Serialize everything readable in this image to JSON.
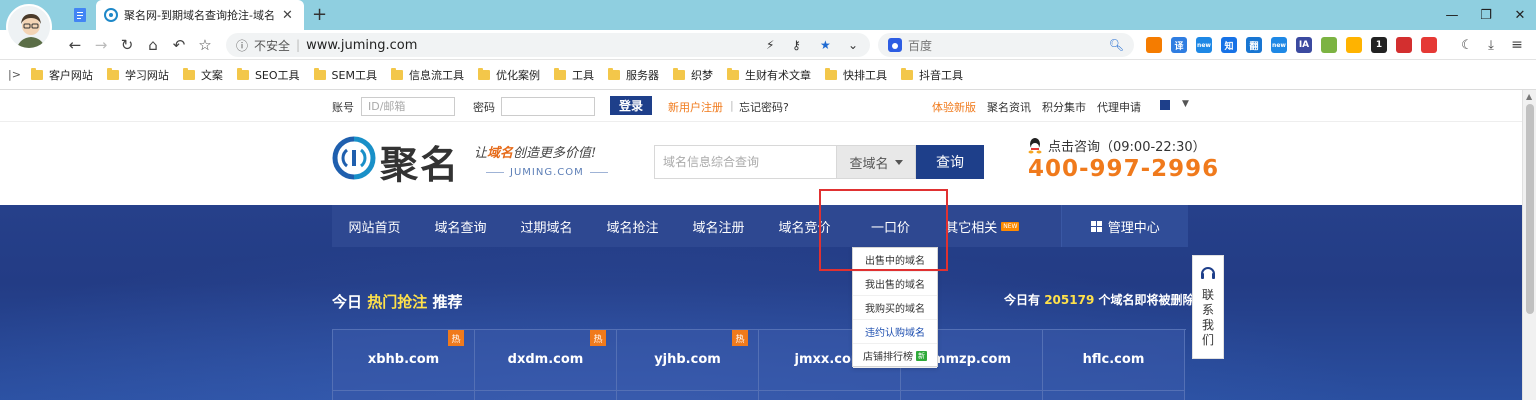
{
  "browser": {
    "tabs": [
      {
        "title": ""
      },
      {
        "title": "聚名网-到期域名查询抢注-域名注"
      }
    ],
    "new_tab_glyph": "+",
    "window_controls": {
      "minimize": "—",
      "restore": "❐",
      "close": "✕"
    },
    "address": {
      "security": "不安全",
      "url": "www.juming.com"
    },
    "search_engine_placeholder": "百度",
    "extensions": [
      {
        "label": "",
        "color": "#f57c00"
      },
      {
        "label": "译",
        "color": "#2f7de1"
      },
      {
        "label": "new",
        "color": "#1e88e5"
      },
      {
        "label": "知",
        "color": "#1772e6"
      },
      {
        "label": "翻",
        "color": "#1976d2"
      },
      {
        "label": "new",
        "color": "#1e88e5"
      },
      {
        "label": "IA",
        "color": "#3b4aa0"
      },
      {
        "label": "",
        "color": "#7cb342"
      },
      {
        "label": "",
        "color": "#ffb300"
      },
      {
        "label": "1",
        "color": "#222222"
      },
      {
        "label": "",
        "color": "#d32f2f"
      },
      {
        "label": "",
        "color": "#e53935"
      }
    ],
    "bookmarks": [
      "客户网站",
      "学习网站",
      "文案",
      "SEO工具",
      "SEM工具",
      "信息流工具",
      "优化案例",
      "工具",
      "服务器",
      "织梦",
      "生财有术文章",
      "快排工具",
      "抖音工具"
    ]
  },
  "topbar": {
    "account_label": "账号",
    "account_placeholder": "ID/邮箱",
    "password_label": "密码",
    "login": "登录",
    "register": "新用户注册",
    "forgot": "忘记密码?",
    "links": [
      "体验新版",
      "聚名资讯",
      "积分集市",
      "代理申请"
    ]
  },
  "header": {
    "logo_text": "聚名",
    "slogan_pre": "让",
    "slogan_hl": "域名",
    "slogan_post": "创造更多价值!",
    "slogan_sub": "JUMING.COM",
    "search_placeholder": "域名信息综合查询",
    "search_select": "查域名",
    "search_button": "查询",
    "contact": "点击咨询（09:00-22:30）",
    "phone": "400-997-2996"
  },
  "nav": {
    "items": [
      "网站首页",
      "域名查询",
      "过期域名",
      "域名抢注",
      "域名注册",
      "域名竞价",
      "一口价",
      "其它相关"
    ],
    "new_tag": "NEW",
    "management": "管理中心"
  },
  "dropdown": {
    "items": [
      "出售中的域名",
      "我出售的域名",
      "我购买的域名",
      "违约认购域名",
      "店铺排行榜"
    ],
    "new_badge": "新"
  },
  "section": {
    "title_pre": "今日",
    "title_hot": "热门抢注",
    "title_post": "推荐",
    "right_pre": "今日有",
    "right_num": "205179",
    "right_post": "个域名即将被删除"
  },
  "tiles": [
    {
      "domain": "xbhb.com",
      "tag": "热"
    },
    {
      "domain": "dxdm.com",
      "tag": "热"
    },
    {
      "domain": "yjhb.com",
      "tag": "热"
    },
    {
      "domain": "jmxx.com",
      "tag": ""
    },
    {
      "domain": "mmzp.com",
      "tag": ""
    },
    {
      "domain": "hflc.com",
      "tag": ""
    }
  ],
  "side_contact": "联系我们",
  "colors": {
    "brand_blue": "#1e3f8a",
    "accent_orange": "#f07a1c",
    "highlight_red": "#e03131"
  }
}
